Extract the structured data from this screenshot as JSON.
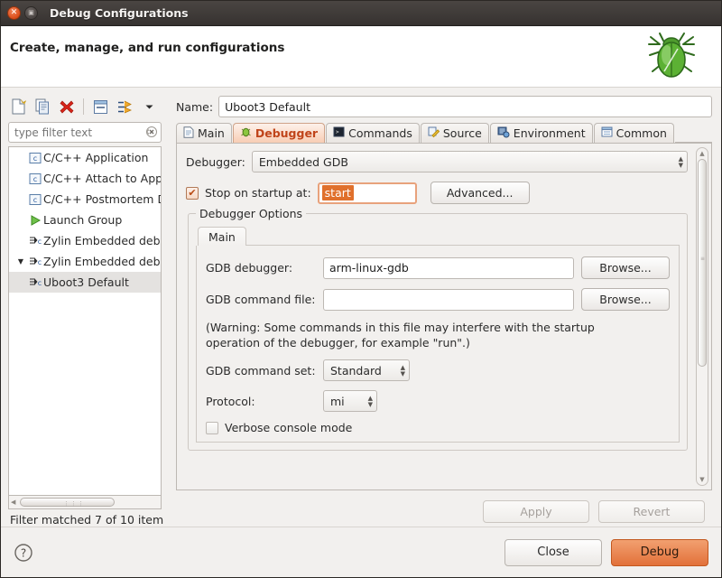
{
  "window": {
    "title": "Debug Configurations",
    "close_icon": "window-close-icon",
    "maximize_icon": "window-maximize-icon"
  },
  "banner": {
    "title": "Create, manage, and run configurations",
    "icon": "green-bug-icon"
  },
  "left_panel": {
    "toolbar": [
      {
        "name": "new-configuration-icon",
        "label": "New launch configuration"
      },
      {
        "name": "duplicate-configuration-icon",
        "label": "Duplicate"
      },
      {
        "name": "delete-configuration-icon",
        "label": "Delete"
      },
      {
        "name": "collapse-all-icon",
        "label": "Collapse All"
      },
      {
        "name": "filter-configurations-icon",
        "label": "Filter"
      },
      {
        "name": "chevron-down-icon",
        "label": "Menu"
      }
    ],
    "filter": {
      "placeholder": "type filter text",
      "value": "",
      "clear_icon": "clear-filter-icon"
    },
    "tree": [
      {
        "label": "C/C++ Application",
        "icon": "c-cpp-icon",
        "indent": 0,
        "expander": "",
        "selected": false
      },
      {
        "label": "C/C++ Attach to Appli",
        "icon": "c-cpp-icon",
        "indent": 0,
        "expander": "",
        "selected": false
      },
      {
        "label": "C/C++ Postmortem De",
        "icon": "c-cpp-icon",
        "indent": 0,
        "expander": "",
        "selected": false
      },
      {
        "label": "Launch Group",
        "icon": "launch-group-icon",
        "indent": 0,
        "expander": "",
        "selected": false
      },
      {
        "label": "Zylin Embedded debu",
        "icon": "zylin-icon",
        "indent": 0,
        "expander": "",
        "selected": false
      },
      {
        "label": "Zylin Embedded debu",
        "icon": "zylin-icon",
        "indent": 0,
        "expander": "▼",
        "selected": false
      },
      {
        "label": "Uboot3 Default",
        "icon": "zylin-icon",
        "indent": 1,
        "expander": "",
        "selected": true
      }
    ],
    "status": "Filter matched 7 of 10 item"
  },
  "config": {
    "name_label": "Name:",
    "name_value": "Uboot3 Default",
    "tabs": [
      {
        "label": "Main",
        "icon": "document-icon",
        "active": false
      },
      {
        "label": "Debugger",
        "icon": "bug-icon",
        "active": true
      },
      {
        "label": "Commands",
        "icon": "console-icon",
        "active": false
      },
      {
        "label": "Source",
        "icon": "source-icon",
        "active": false
      },
      {
        "label": "Environment",
        "icon": "environment-icon",
        "active": false
      },
      {
        "label": "Common",
        "icon": "common-icon",
        "active": false
      }
    ]
  },
  "debugger_tab": {
    "debugger_label": "Debugger:",
    "debugger_value": "Embedded GDB",
    "stop_on_startup_label": "Stop on startup at:",
    "stop_on_startup_checked": true,
    "stop_on_startup_value": "start",
    "advanced_button": "Advanced...",
    "options_group_title": "Debugger Options",
    "inner_tab": "Main",
    "gdb_debugger_label": "GDB debugger:",
    "gdb_debugger_value": "arm-linux-gdb",
    "gdb_command_file_label": "GDB command file:",
    "gdb_command_file_value": "",
    "browse_button_1": "Browse...",
    "browse_button_2": "Browse...",
    "warning": "(Warning: Some commands in this file may interfere with the startup operation of the debugger, for example \"run\".)",
    "command_set_label": "GDB command set:",
    "command_set_value": "Standard",
    "protocol_label": "Protocol:",
    "protocol_value": "mi",
    "verbose_label": "Verbose console mode",
    "verbose_checked": false
  },
  "action_bar": {
    "apply_label": "Apply",
    "revert_label": "Revert",
    "apply_enabled": false,
    "revert_enabled": false
  },
  "footer": {
    "help_icon": "help-icon",
    "close_label": "Close",
    "debug_label": "Debug"
  },
  "colors": {
    "accent_orange": "#e2713a",
    "selection_orange": "#e0702c",
    "active_tab_text": "#c0441a",
    "titlebar": "#3c3835"
  }
}
